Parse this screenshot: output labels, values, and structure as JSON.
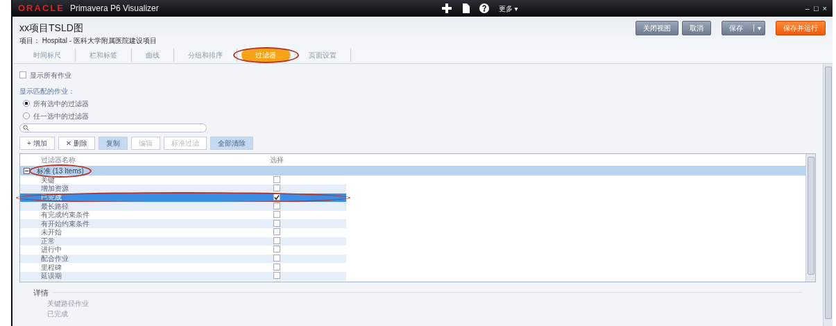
{
  "app": {
    "logo": "ORACLE",
    "name": "Primavera P6 Visualizer",
    "more": "更多",
    "more_caret": "▾",
    "window_controls": [
      "–",
      "□",
      "×"
    ]
  },
  "header": {
    "title": "xx项目TSLD图",
    "project": "项目： Hospital - 医科大学附属医院建设项目",
    "buttons": [
      {
        "label": "关闭视图",
        "kind": "plain"
      },
      {
        "label": "取消",
        "kind": "plain"
      },
      {
        "label": "保存",
        "kind": "split",
        "caret": "▾"
      },
      {
        "label": "保存并运行",
        "kind": "primary"
      }
    ]
  },
  "tabs": [
    {
      "label": "时间标尺",
      "selected": false,
      "annotated": false
    },
    {
      "label": "栏和标签",
      "selected": false,
      "annotated": false
    },
    {
      "label": "曲线",
      "selected": false,
      "annotated": false
    },
    {
      "label": "分组和排序",
      "selected": false,
      "annotated": false
    },
    {
      "label": "过滤器",
      "selected": true,
      "annotated": true
    },
    {
      "label": "页面设置",
      "selected": false,
      "annotated": false
    }
  ],
  "filter": {
    "show_all": {
      "label": "显示所有作业",
      "checked": false
    },
    "match_label": "显示匹配的作业：",
    "radios": [
      {
        "label": "所有选中的过滤器",
        "selected": true
      },
      {
        "label": "任一选中的过滤器",
        "selected": false
      }
    ],
    "toolbar": [
      {
        "label": "+ 增加",
        "disabled": false,
        "accent": false
      },
      {
        "label": "✕ 删除",
        "disabled": false,
        "accent": false
      },
      {
        "label": "复制",
        "disabled": false,
        "accent": true
      },
      {
        "label": "编辑",
        "disabled": true,
        "accent": false
      },
      {
        "label": "标准过滤",
        "disabled": true,
        "accent": false
      },
      {
        "label": "全部清除",
        "disabled": false,
        "accent": true
      }
    ],
    "columns": [
      "过滤器名称",
      "选择"
    ],
    "group": {
      "label": "标准 (13 Items)",
      "expanded": true,
      "annotated": true,
      "rows": [
        {
          "name": "关键",
          "checked": false,
          "selected": false,
          "annotated": false
        },
        {
          "name": "增加资源",
          "checked": false,
          "selected": false,
          "annotated": false
        },
        {
          "name": "已完成",
          "checked": true,
          "selected": true,
          "annotated": true
        },
        {
          "name": "最长路径",
          "checked": false,
          "selected": false,
          "annotated": false
        },
        {
          "name": "有完成约束条件",
          "checked": false,
          "selected": false,
          "annotated": false
        },
        {
          "name": "有开始约束条件",
          "checked": false,
          "selected": false,
          "annotated": false
        },
        {
          "name": "未开始",
          "checked": false,
          "selected": false,
          "annotated": false
        },
        {
          "name": "正常",
          "checked": false,
          "selected": false,
          "annotated": false
        },
        {
          "name": "进行中",
          "checked": false,
          "selected": false,
          "annotated": false
        },
        {
          "name": "配合作业",
          "checked": false,
          "selected": false,
          "annotated": false
        },
        {
          "name": "里程碑",
          "checked": false,
          "selected": false,
          "annotated": false
        },
        {
          "name": "延误期",
          "checked": false,
          "selected": false,
          "annotated": false
        }
      ]
    }
  },
  "details": {
    "title": "详情",
    "lines": [
      "关键路径作业",
      "已完成"
    ]
  }
}
